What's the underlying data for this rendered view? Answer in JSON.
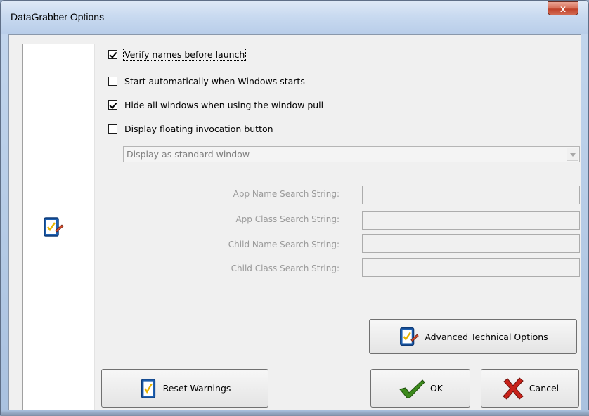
{
  "window": {
    "title": "DataGrabber Options",
    "close_label": "x"
  },
  "options": {
    "verify_names": {
      "label": "Verify names before launch",
      "checked": true
    },
    "start_auto": {
      "label": "Start automatically when Windows starts",
      "checked": false
    },
    "hide_windows": {
      "label": "Hide all windows when using the window pull",
      "checked": true
    },
    "floating_button": {
      "label": "Display floating invocation button",
      "checked": false
    }
  },
  "display_mode": {
    "selected": "Display as standard window"
  },
  "search_fields": {
    "app_name": {
      "label": "App Name Search String:",
      "value": ""
    },
    "app_class": {
      "label": "App Class Search String:",
      "value": ""
    },
    "child_name": {
      "label": "Child Name Search String:",
      "value": ""
    },
    "child_class": {
      "label": "Child Class Search String:",
      "value": ""
    }
  },
  "buttons": {
    "advanced": "Advanced Technical Options",
    "reset": "Reset Warnings",
    "ok": "OK",
    "cancel": "Cancel"
  },
  "icons": {
    "sidebar": "checklist-icon",
    "advanced": "checklist-pencil-icon",
    "reset": "checklist-icon",
    "ok": "green-check-icon",
    "cancel": "red-x-icon"
  },
  "colors": {
    "ok_check": "#3c8a1c",
    "cancel_x": "#c8221a",
    "icon_blue": "#1d5fb0"
  }
}
